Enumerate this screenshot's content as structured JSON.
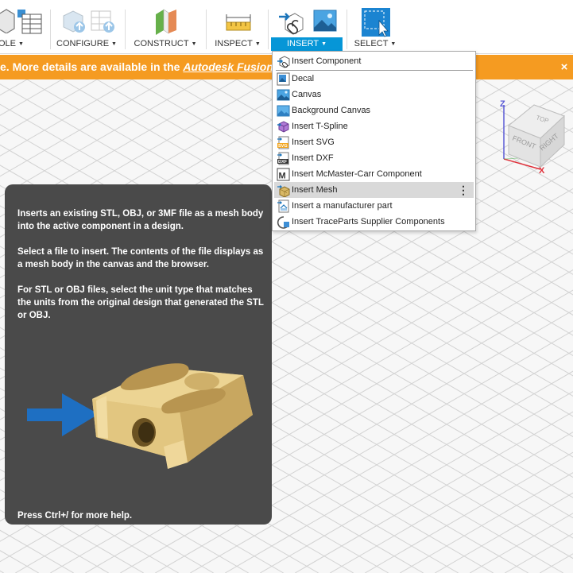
{
  "toolbar": {
    "groups": [
      {
        "label": "OLE"
      },
      {
        "label": "CONFIGURE"
      },
      {
        "label": "CONSTRUCT"
      },
      {
        "label": "INSPECT"
      },
      {
        "label": "INSERT"
      },
      {
        "label": "SELECT"
      }
    ]
  },
  "banner": {
    "text": "e. More details are available in the ",
    "link": "Autodesk Fusion ne",
    "close": "×"
  },
  "insert_menu": {
    "items": [
      {
        "label": "Insert Component",
        "icon": "insert-component-icon"
      },
      {
        "label": "Decal",
        "icon": "decal-icon"
      },
      {
        "label": "Canvas",
        "icon": "canvas-icon"
      },
      {
        "label": "Background Canvas",
        "icon": "background-canvas-icon"
      },
      {
        "label": "Insert T-Spline",
        "icon": "t-spline-icon"
      },
      {
        "label": "Insert SVG",
        "icon": "svg-file-icon"
      },
      {
        "label": "Insert DXF",
        "icon": "dxf-file-icon"
      },
      {
        "label": "Insert McMaster-Carr Component",
        "icon": "mcmaster-carr-icon"
      },
      {
        "label": "Insert Mesh",
        "icon": "insert-mesh-icon"
      },
      {
        "label": "Insert a manufacturer part",
        "icon": "manufacturer-part-icon"
      },
      {
        "label": "Insert TraceParts Supplier Components",
        "icon": "traceparts-icon"
      }
    ],
    "highlighted": "Insert Mesh",
    "more_glyph": "⋮"
  },
  "tooltip": {
    "p1": "Inserts an existing STL, OBJ, or 3MF file as a mesh body into the active component in a design.",
    "p2": "Select a file to insert. The contents of the file displays as a mesh body in the canvas and the browser.",
    "p3": "For STL or OBJ files, select the unit type that matches the units from the original design that generated the STL or OBJ.",
    "footer": "Press Ctrl+/ for more help."
  },
  "viewcube": {
    "faces": {
      "top": "TOP",
      "front": "FRONT",
      "right": "RIGHT"
    },
    "axes": {
      "z": "Z",
      "x": "X"
    }
  },
  "colors": {
    "accent": "#0696d7",
    "banner": "#f59b21",
    "tooltip_bg": "#4a4a4a",
    "axis_z": "#5b5bd6",
    "axis_x": "#e0303a"
  }
}
